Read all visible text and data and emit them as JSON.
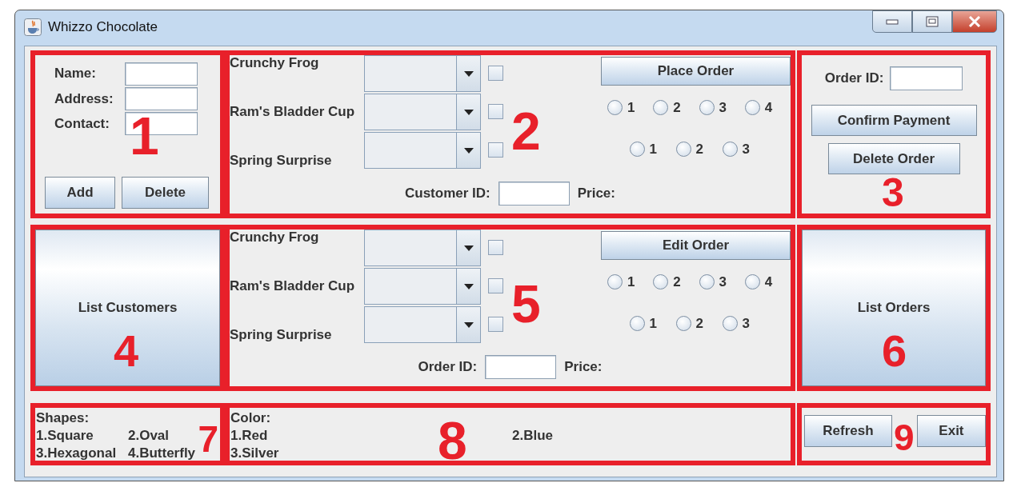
{
  "window": {
    "title": "Whizzo Chocolate"
  },
  "customer_panel": {
    "fields": [
      {
        "label": "Name:"
      },
      {
        "label": "Address:"
      },
      {
        "label": "Contact:"
      }
    ],
    "buttons": [
      "Add",
      "Delete"
    ]
  },
  "order_panels": [
    {
      "products": [
        {
          "name": "Crunchy Frog",
          "checked": false
        },
        {
          "name": "Ram's Bladder Cup",
          "checked": false
        },
        {
          "name": "Spring Surprise",
          "checked": false
        }
      ],
      "action": "Place Order",
      "radio_groups": [
        [
          {
            "label": "1",
            "selected": false
          },
          {
            "label": "2",
            "selected": false
          },
          {
            "label": "3",
            "selected": false
          },
          {
            "label": "4",
            "selected": false
          }
        ],
        [
          {
            "label": "1",
            "selected": false
          },
          {
            "label": "2",
            "selected": false
          },
          {
            "label": "3",
            "selected": false
          }
        ]
      ],
      "id_label": "Customer ID:",
      "price_label": "Price:"
    },
    {
      "products": [
        {
          "name": "Crunchy Frog",
          "checked": false
        },
        {
          "name": "Ram's Bladder Cup",
          "checked": false
        },
        {
          "name": "Spring Surprise",
          "checked": false
        }
      ],
      "action": "Edit Order",
      "radio_groups": [
        [
          {
            "label": "1",
            "selected": false
          },
          {
            "label": "2",
            "selected": false
          },
          {
            "label": "3",
            "selected": false
          },
          {
            "label": "4",
            "selected": false
          }
        ],
        [
          {
            "label": "1",
            "selected": false
          },
          {
            "label": "2",
            "selected": false
          },
          {
            "label": "3",
            "selected": false
          }
        ]
      ],
      "id_label": "Order ID:",
      "price_label": "Price:"
    }
  ],
  "payment_panel": {
    "id_label": "Order ID:",
    "buttons": [
      "Confirm Payment",
      "Delete Order"
    ]
  },
  "list_buttons": [
    "List Customers",
    "List Orders"
  ],
  "shapes": {
    "title": "Shapes:",
    "items": [
      "1.Square",
      "2.Oval",
      "3.Hexagonal",
      "4.Butterfly"
    ]
  },
  "colors": {
    "title": "Color:",
    "items": [
      "1.Red",
      "2.Blue",
      "3.Silver"
    ]
  },
  "footer_buttons": [
    "Refresh",
    "Exit"
  ],
  "annotations": [
    "1",
    "2",
    "3",
    "4",
    "5",
    "6",
    "7",
    "8",
    "9"
  ]
}
